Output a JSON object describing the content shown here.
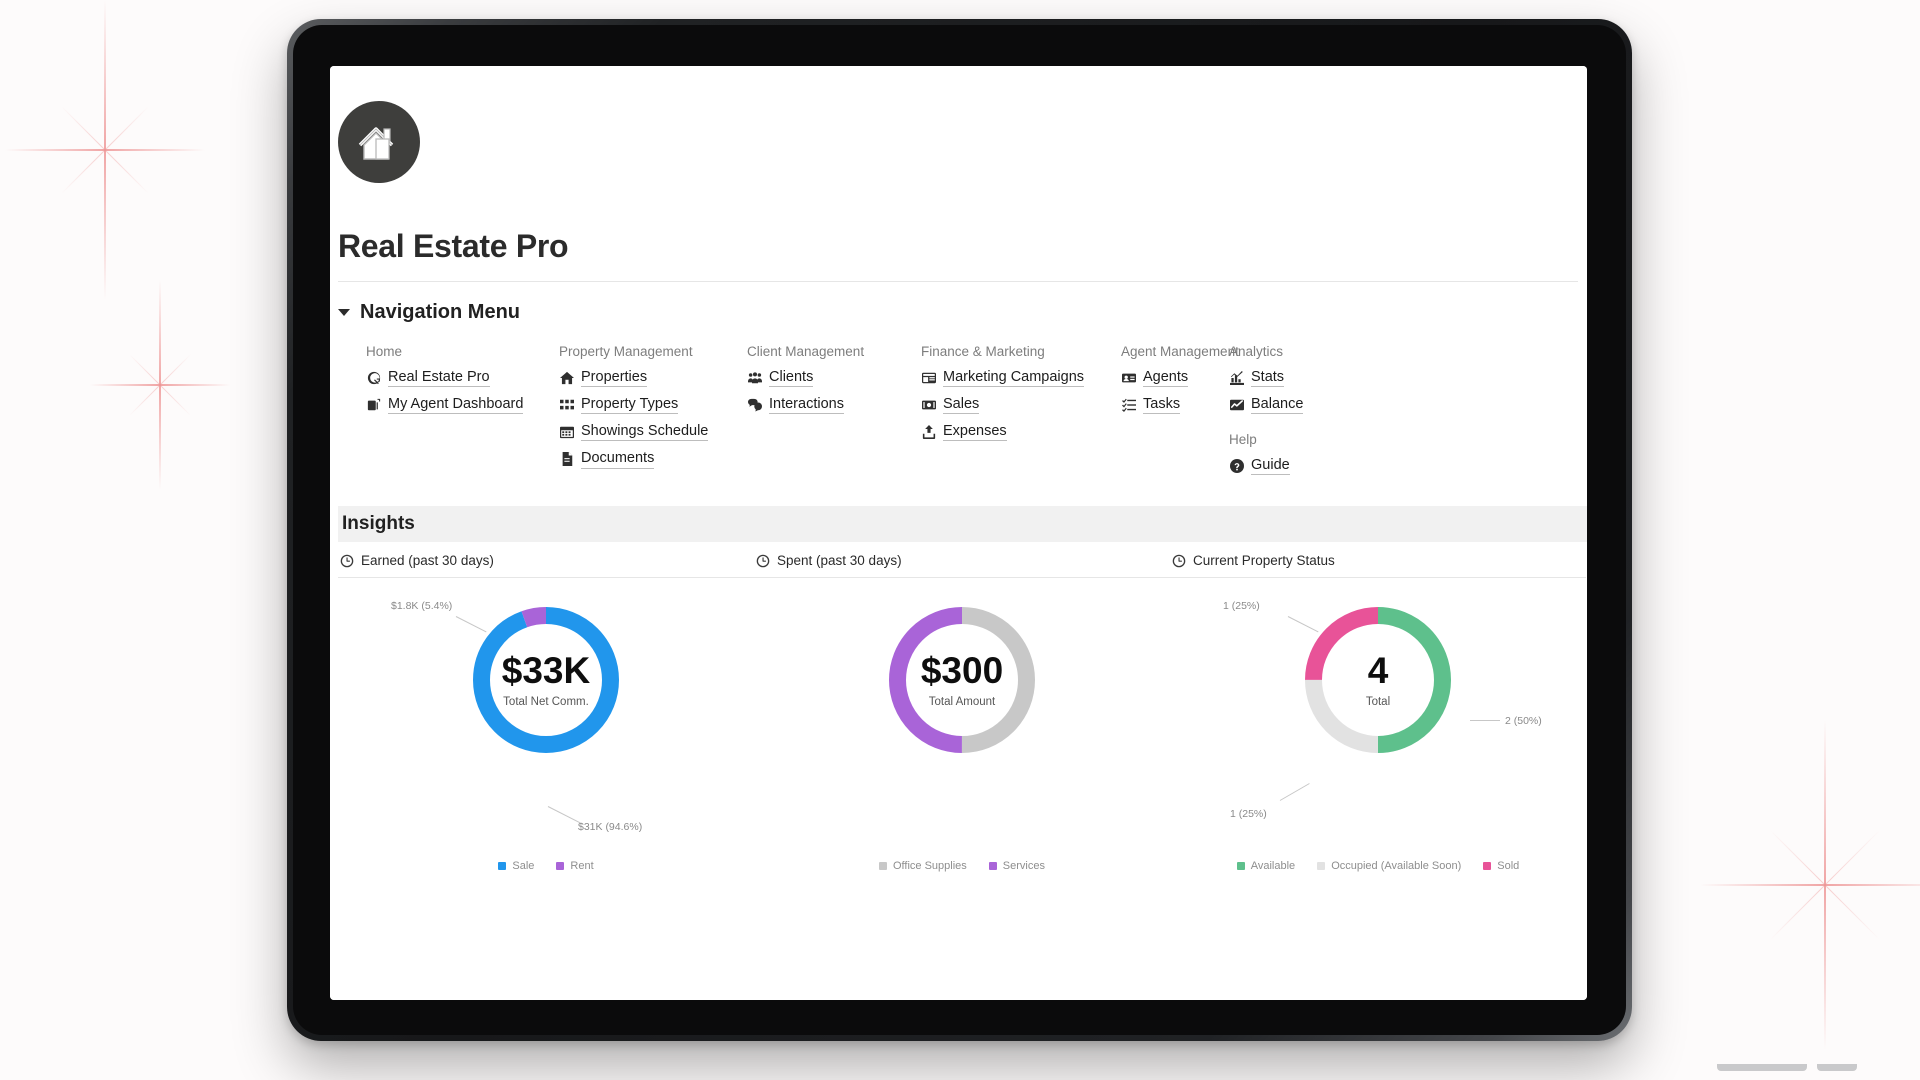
{
  "app": {
    "icon": "house-logo-icon",
    "title": "Real Estate Pro"
  },
  "navigation": {
    "title": "Navigation Menu",
    "caret": "chevron-down-icon",
    "columns": [
      {
        "groups": [
          {
            "label": "Home",
            "items": [
              {
                "label": "Real Estate Pro",
                "icon": "external-link-circle-icon"
              },
              {
                "label": "My Agent Dashboard",
                "icon": "dashboard-copy-icon"
              }
            ]
          }
        ]
      },
      {
        "groups": [
          {
            "label": "Property Management",
            "items": [
              {
                "label": "Properties",
                "icon": "house-icon"
              },
              {
                "label": "Property Types",
                "icon": "grid-rows-icon"
              },
              {
                "label": "Showings Schedule",
                "icon": "calendar-icon"
              },
              {
                "label": "Documents",
                "icon": "document-icon"
              }
            ]
          }
        ]
      },
      {
        "groups": [
          {
            "label": "Client Management",
            "items": [
              {
                "label": "Clients",
                "icon": "people-group-icon"
              },
              {
                "label": "Interactions",
                "icon": "chat-bubbles-icon"
              }
            ]
          }
        ]
      },
      {
        "groups": [
          {
            "label": "Finance & Marketing",
            "items": [
              {
                "label": "Marketing Campaigns",
                "icon": "megaphone-board-icon"
              },
              {
                "label": "Sales",
                "icon": "money-bill-icon"
              },
              {
                "label": "Expenses",
                "icon": "upload-box-icon"
              }
            ]
          }
        ]
      },
      {
        "groups": [
          {
            "label": "Agent Management",
            "items": [
              {
                "label": "Agents",
                "icon": "id-badge-icon"
              },
              {
                "label": "Tasks",
                "icon": "task-list-icon"
              }
            ]
          }
        ]
      },
      {
        "groups": [
          {
            "label": "Analytics",
            "items": [
              {
                "label": "Stats",
                "icon": "bar-chart-icon"
              },
              {
                "label": "Balance",
                "icon": "line-chart-icon"
              }
            ]
          },
          {
            "label": "Help",
            "items": [
              {
                "label": "Guide",
                "icon": "question-circle-icon"
              }
            ]
          }
        ]
      }
    ]
  },
  "insights": {
    "title": "Insights",
    "cards": [
      {
        "title": "Earned (past 30 days)",
        "icon": "clock-icon",
        "center_value": "$33K",
        "center_label": "Total Net Comm.",
        "callouts": [
          {
            "text": "$1.8K (5.4%)",
            "position": "top-left"
          },
          {
            "text": "$31K (94.6%)",
            "position": "bottom-right"
          }
        ]
      },
      {
        "title": "Spent (past 30 days)",
        "icon": "clock-icon",
        "center_value": "$300",
        "center_label": "Total Amount",
        "callouts": []
      },
      {
        "title": "Current Property Status",
        "icon": "clock-icon",
        "center_value": "4",
        "center_label": "Total",
        "callouts": [
          {
            "text": "1 (25%)",
            "position": "top-left"
          },
          {
            "text": "2 (50%)",
            "position": "right"
          },
          {
            "text": "1 (25%)",
            "position": "bottom-left"
          }
        ]
      }
    ]
  },
  "chart_data": [
    {
      "type": "pie",
      "title": "Earned (past 30 days)",
      "center_value": "$33K",
      "center_label": "Total Net Comm.",
      "categories": [
        "Sale",
        "Rent"
      ],
      "values": [
        31000,
        1800
      ],
      "percentages": [
        94.6,
        5.4
      ],
      "value_labels": [
        "$31K (94.6%)",
        "$1.8K (5.4%)"
      ],
      "colors": [
        "#2196ec",
        "#a964d8"
      ],
      "legend": [
        "Sale",
        "Rent"
      ],
      "legend_position": "bottom",
      "donut": true
    },
    {
      "type": "pie",
      "title": "Spent (past 30 days)",
      "center_value": "$300",
      "center_label": "Total Amount",
      "categories": [
        "Office Supplies",
        "Services"
      ],
      "values": [
        150,
        150
      ],
      "percentages": [
        50,
        50
      ],
      "value_labels": [],
      "colors": [
        "#c8c8c8",
        "#a964d8"
      ],
      "legend": [
        "Office Supplies",
        "Services"
      ],
      "legend_position": "bottom",
      "donut": true
    },
    {
      "type": "pie",
      "title": "Current Property Status",
      "center_value": "4",
      "center_label": "Total",
      "categories": [
        "Available",
        "Occupied (Available Soon)",
        "Sold"
      ],
      "values": [
        2,
        1,
        1
      ],
      "percentages": [
        50,
        25,
        25
      ],
      "value_labels": [
        "2 (50%)",
        "1 (25%)",
        "1 (25%)"
      ],
      "colors": [
        "#5ec08c",
        "#e2e2e2",
        "#e85398"
      ],
      "legend": [
        "Available",
        "Occupied (Available Soon)",
        "Sold"
      ],
      "legend_position": "bottom",
      "donut": true
    }
  ],
  "colors": {
    "sale_blue": "#2196ec",
    "rent_purple": "#a964d8",
    "neutral_gray": "#c8c8c8",
    "available_green": "#5ec08c",
    "occupied_gray": "#e2e2e2",
    "sold_pink": "#e85398",
    "logo_bg": "#3e3e3c"
  }
}
